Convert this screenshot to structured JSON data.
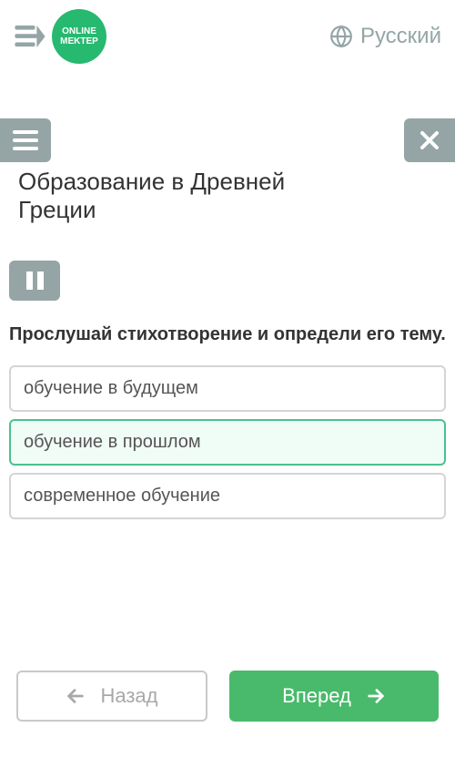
{
  "header": {
    "logo_line1": "ONLINE",
    "logo_line2": "MEKTEP",
    "language": "Русский"
  },
  "lesson": {
    "title": "Образование в Древней Греции",
    "question": "Прослушай стихотворение и определи его тему.",
    "options": [
      {
        "label": "обучение в будущем",
        "selected": false
      },
      {
        "label": "обучение в прошлом",
        "selected": true
      },
      {
        "label": "современное обучение",
        "selected": false
      }
    ]
  },
  "nav": {
    "back": "Назад",
    "forward": "Вперед"
  }
}
